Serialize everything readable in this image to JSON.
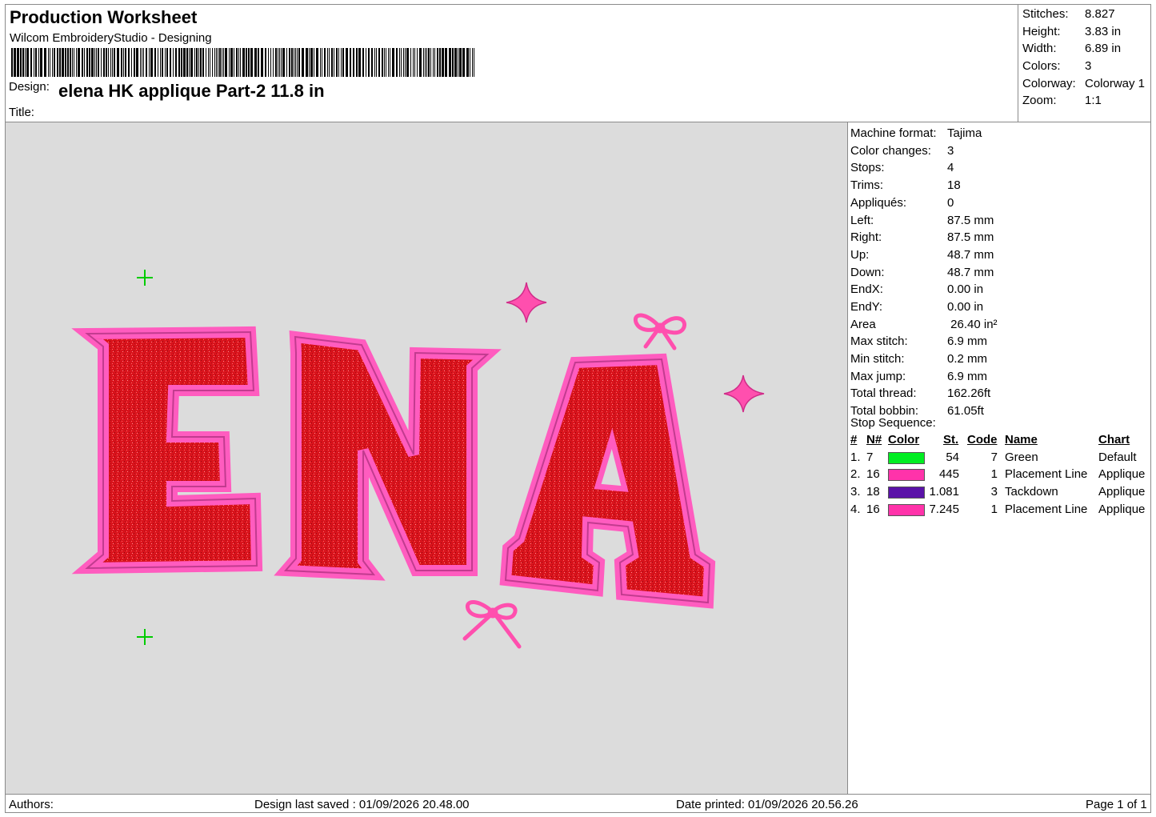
{
  "header": {
    "title": "Production Worksheet",
    "software": "Wilcom EmbroideryStudio - Designing",
    "design_label": "Design:",
    "design_name": "elena HK applique Part-2 11.8 in",
    "title_label": "Title:"
  },
  "summary": [
    {
      "label": "Stitches:",
      "value": "8.827"
    },
    {
      "label": "Height:",
      "value": "3.83 in"
    },
    {
      "label": "Width:",
      "value": "6.89 in"
    },
    {
      "label": "Colors:",
      "value": "3"
    },
    {
      "label": "Colorway:",
      "value": "Colorway 1"
    },
    {
      "label": "Zoom:",
      "value": "1:1"
    }
  ],
  "details": [
    {
      "label": "Machine format:",
      "value": "Tajima"
    },
    {
      "label": "Color changes:",
      "value": "3"
    },
    {
      "label": "Stops:",
      "value": "4"
    },
    {
      "label": "Trims:",
      "value": "18"
    },
    {
      "label": "Appliqués:",
      "value": "0"
    },
    {
      "label": "Left:",
      "value": "87.5 mm"
    },
    {
      "label": "Right:",
      "value": "87.5 mm"
    },
    {
      "label": "Up:",
      "value": "48.7 mm"
    },
    {
      "label": "Down:",
      "value": "48.7 mm"
    },
    {
      "label": "EndX:",
      "value": "0.00 in"
    },
    {
      "label": "EndY:",
      "value": "0.00 in"
    },
    {
      "label": "Area",
      "value": " 26.40 in²"
    },
    {
      "label": "Max stitch:",
      "value": "6.9 mm"
    },
    {
      "label": "Min stitch:",
      "value": "0.2 mm"
    },
    {
      "label": "Max jump:",
      "value": "6.9 mm"
    },
    {
      "label": "Total thread:",
      "value": "162.26ft"
    },
    {
      "label": "Total bobbin:",
      "value": "61.05ft"
    }
  ],
  "stop_sequence": {
    "label": "Stop Sequence:",
    "headers": {
      "index": "#",
      "number": "N#",
      "color": "Color",
      "stitches": "St.",
      "code": "Code",
      "name": "Name",
      "chart": "Chart"
    },
    "rows": [
      {
        "index": "1.",
        "number": "7",
        "color": "#00ee22",
        "stitches": "54",
        "code": "7",
        "name": "Green",
        "chart": "Default"
      },
      {
        "index": "2.",
        "number": "16",
        "color": "#ff33aa",
        "stitches": "445",
        "code": "1",
        "name": "Placement Line",
        "chart": "Applique"
      },
      {
        "index": "3.",
        "number": "18",
        "color": "#5a12a8",
        "stitches": "1.081",
        "code": "3",
        "name": "Tackdown",
        "chart": "Applique"
      },
      {
        "index": "4.",
        "number": "16",
        "color": "#ff33aa",
        "stitches": "7.245",
        "code": "1",
        "name": "Placement Line",
        "chart": "Applique"
      }
    ]
  },
  "design_preview": {
    "letters": [
      "E",
      "N",
      "A"
    ],
    "fill_color": "#e01b24",
    "outline_color": "#ff5cbf",
    "marker_color": "#00cc00"
  },
  "footer": {
    "authors": "Authors:",
    "saved": "Design last saved : 01/09/2026 20.48.00",
    "printed": "Date printed: 01/09/2026 20.56.26",
    "page": "Page 1 of 1"
  }
}
